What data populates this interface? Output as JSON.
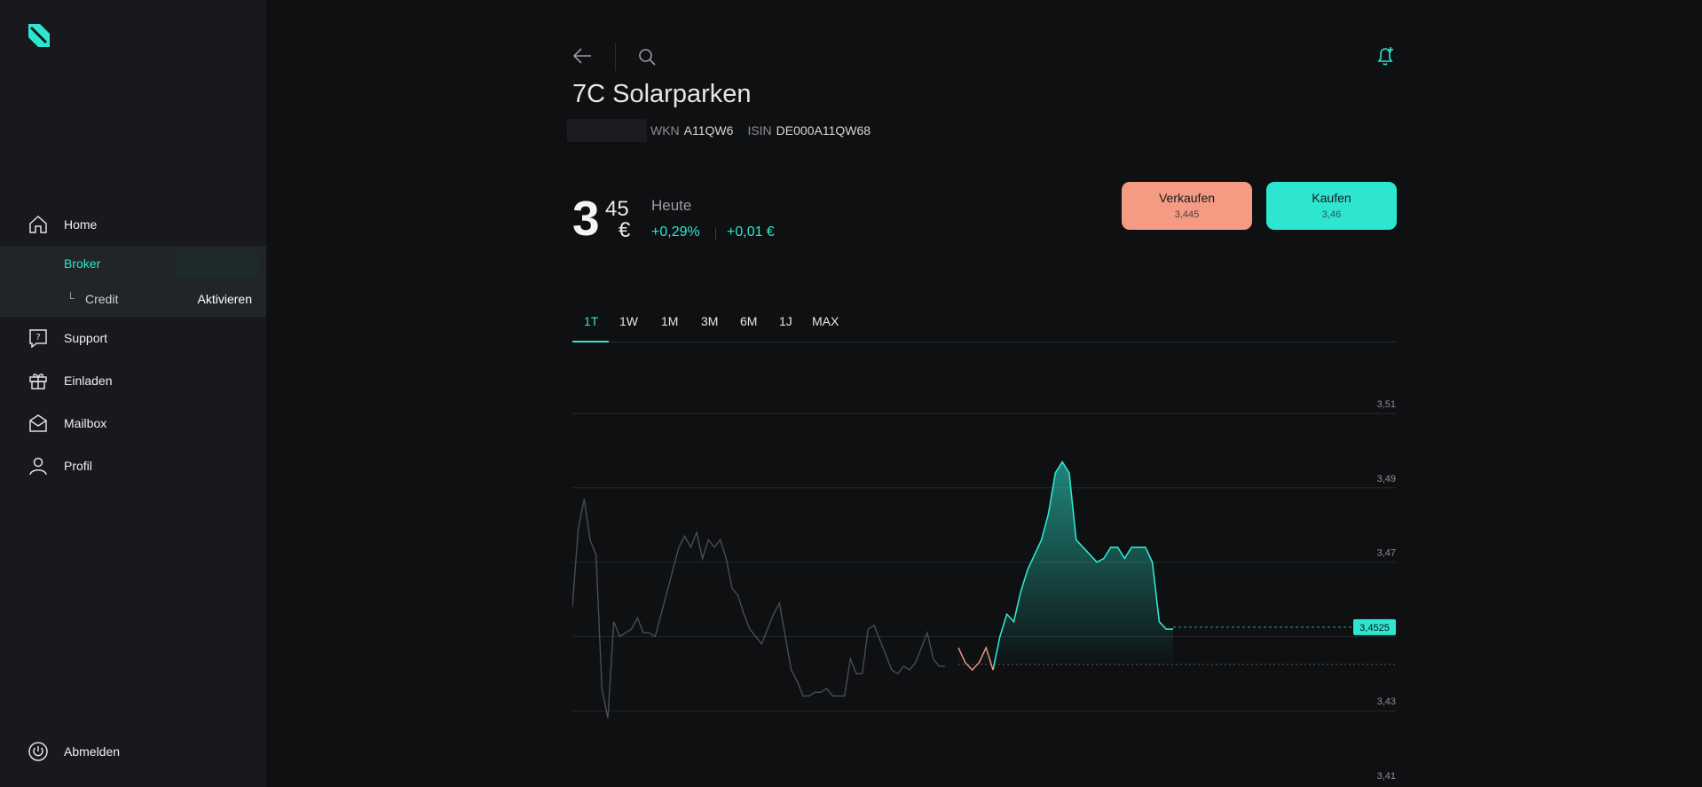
{
  "colors": {
    "accent": "#2ee6cf",
    "sell": "#f59b84",
    "bg": "#0e1012",
    "sidebar": "#17191c"
  },
  "sidebar": {
    "home": "Home",
    "broker": "Broker",
    "credit": "Credit",
    "credit_action": "Aktivieren",
    "support": "Support",
    "invite": "Einladen",
    "mailbox": "Mailbox",
    "profile": "Profil",
    "logout": "Abmelden"
  },
  "header": {
    "title": "7C Solarparken",
    "wkn_label": "WKN",
    "wkn": "A11QW6",
    "isin_label": "ISIN",
    "isin": "DE000A11QW68"
  },
  "price": {
    "integer": "3",
    "decimals": "45",
    "currency": "€",
    "period": "Heute",
    "change_pct": "+0,29%",
    "change_abs": "+0,01 €"
  },
  "actions": {
    "sell_label": "Verkaufen",
    "sell_price": "3,445",
    "buy_label": "Kaufen",
    "buy_price": "3,46"
  },
  "tabs": [
    "1T",
    "1W",
    "1M",
    "3M",
    "6M",
    "1J",
    "MAX"
  ],
  "active_tab": "1T",
  "chart_data": {
    "type": "line",
    "y_ticks": [
      "3,51",
      "3,49",
      "3,47",
      "3,45",
      "3,43",
      "3,41"
    ],
    "ylim": [
      3.41,
      3.51
    ],
    "current_label": "3,4525",
    "current_value": 3.4525,
    "reference_value": 3.4425,
    "previous_series": [
      3.458,
      3.479,
      3.487,
      3.476,
      3.472,
      3.436,
      3.428,
      3.454,
      3.45,
      3.451,
      3.452,
      3.455,
      3.451,
      3.451,
      3.45,
      3.456,
      3.462,
      3.468,
      3.474,
      3.477,
      3.474,
      3.478,
      3.471,
      3.476,
      3.474,
      3.476,
      3.471,
      3.463,
      3.461,
      3.456,
      3.452,
      3.45,
      3.448,
      3.452,
      3.456,
      3.459,
      3.45,
      3.441,
      3.438,
      3.434,
      3.434,
      3.435,
      3.435,
      3.436,
      3.434,
      3.434,
      3.434,
      3.444,
      3.44,
      3.44,
      3.452,
      3.453,
      3.449,
      3.445,
      3.441,
      3.44,
      3.442,
      3.441,
      3.443,
      3.447,
      3.451,
      3.444,
      3.442,
      3.442
    ],
    "today_series": [
      3.447,
      3.443,
      3.441,
      3.443,
      3.447,
      3.441,
      3.45,
      3.456,
      3.454,
      3.462,
      3.468,
      3.472,
      3.476,
      3.483,
      3.494,
      3.497,
      3.494,
      3.476,
      3.474,
      3.472,
      3.47,
      3.471,
      3.474,
      3.474,
      3.471,
      3.474,
      3.474,
      3.474,
      3.47,
      3.454,
      3.452,
      3.452
    ]
  }
}
